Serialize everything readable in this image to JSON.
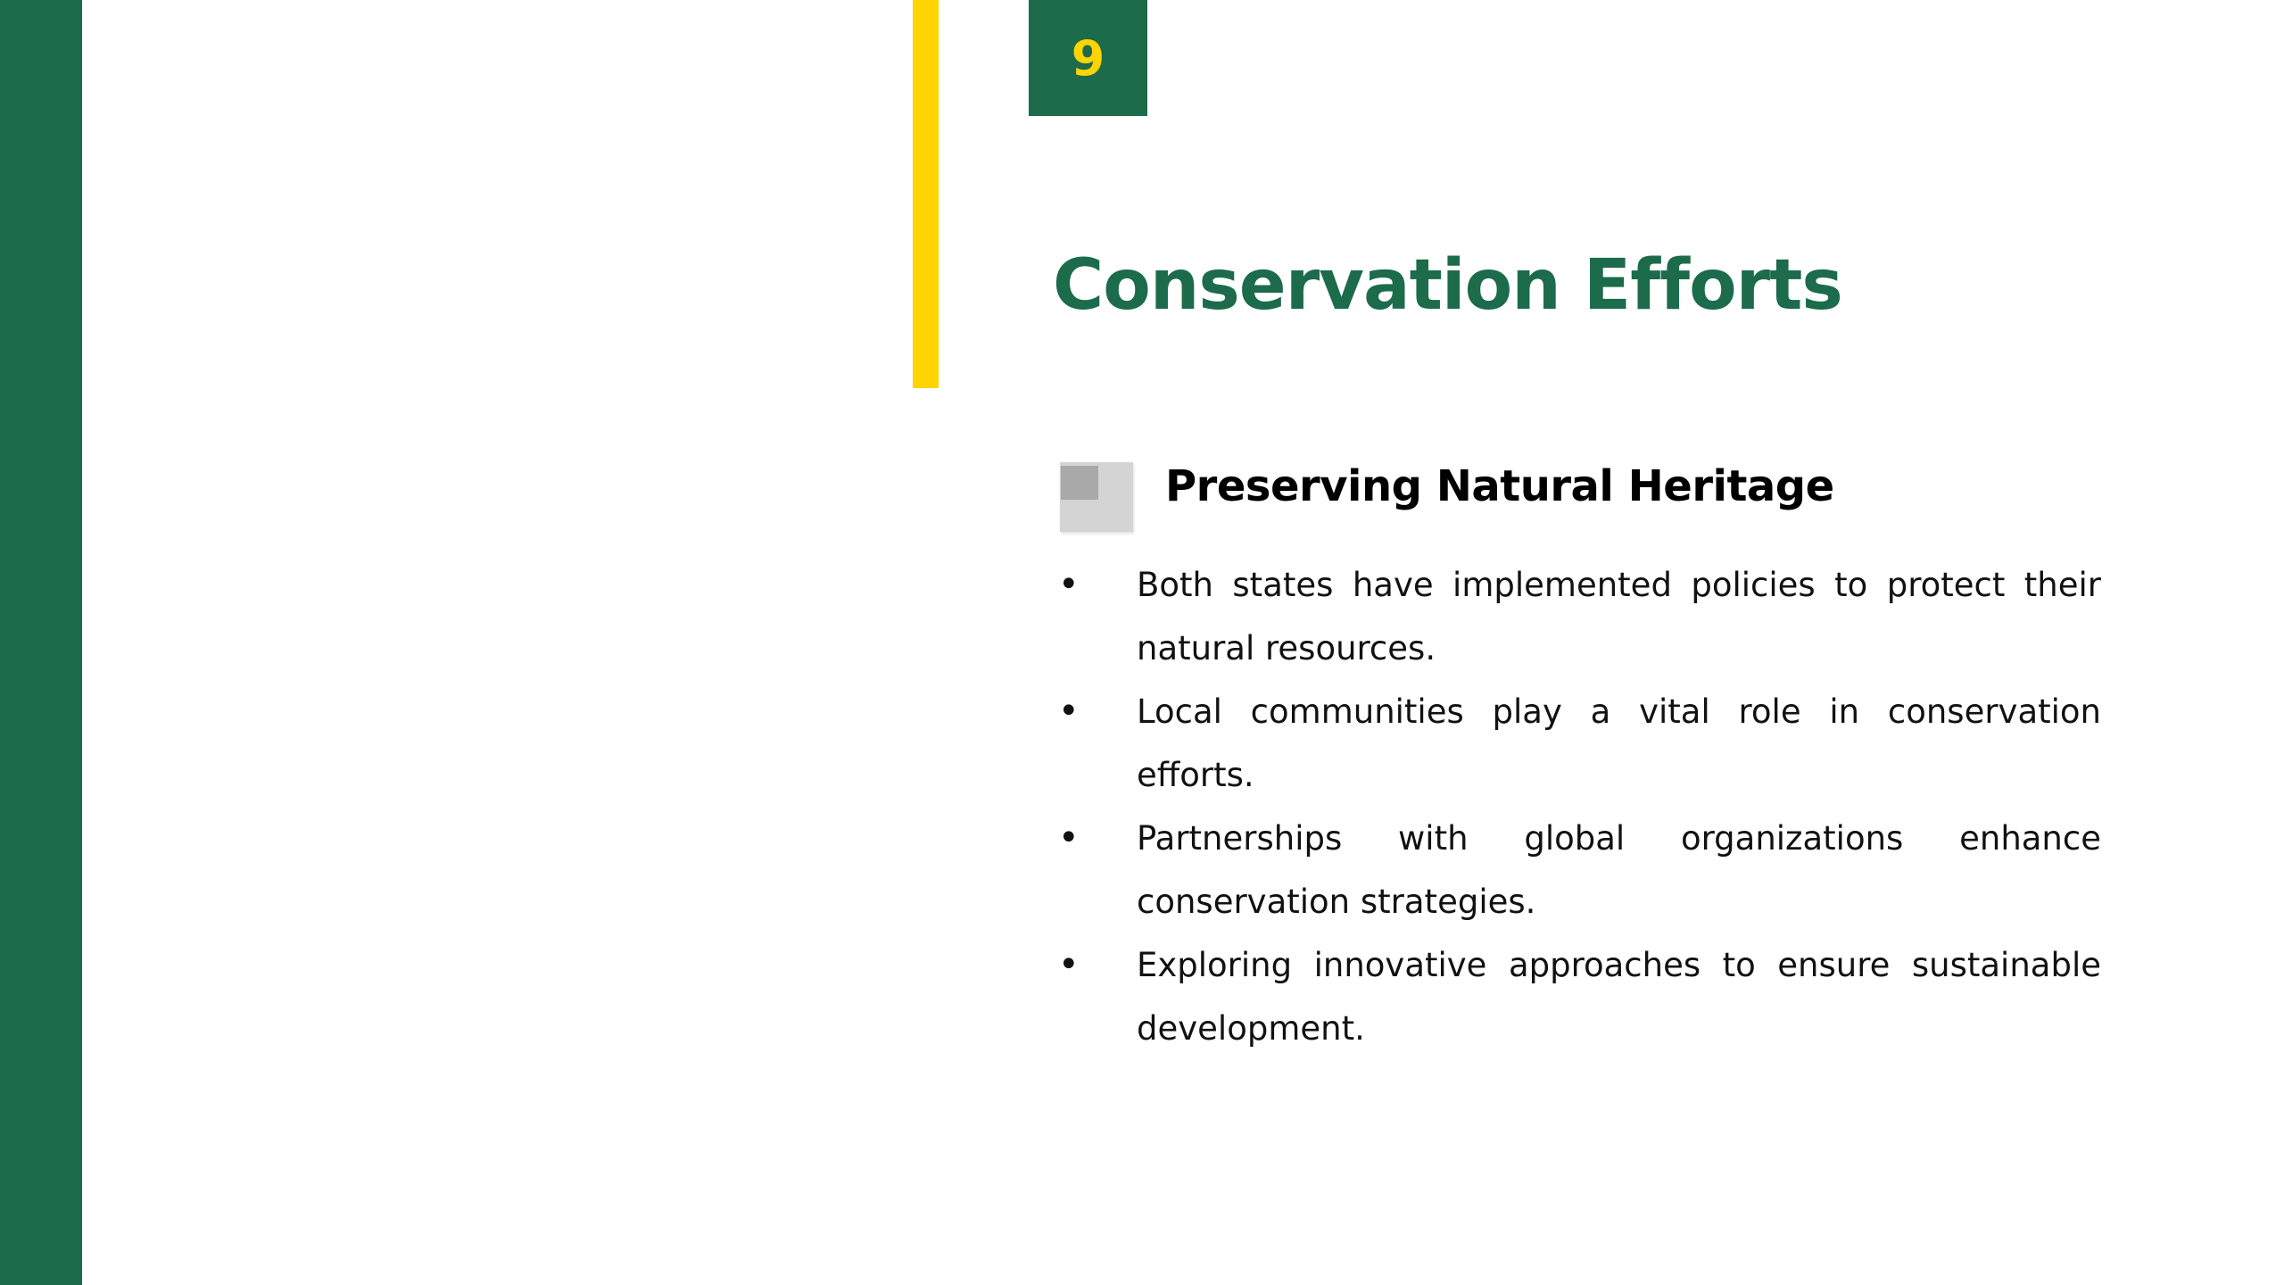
{
  "slide": {
    "page_number": "9",
    "title": "Conservation Efforts",
    "section": {
      "icon": "square-stack-icon",
      "heading": "Preserving Natural Heritage"
    },
    "bullets": [
      "Both states have implemented policies to protect their natural resources.",
      "Local communities play a vital role in conservation efforts.",
      "Partnerships with global organizations enhance conservation strategies.",
      "Exploring innovative approaches to ensure sustainable development."
    ]
  },
  "colors": {
    "brand_green": "#1c6b4b",
    "accent_yellow": "#ffd400",
    "text": "#111111"
  }
}
